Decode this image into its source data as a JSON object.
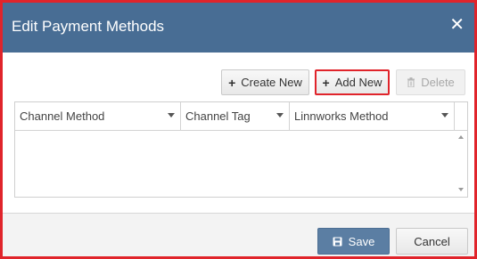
{
  "dialog": {
    "title": "Edit Payment Methods",
    "close_icon": "close-icon",
    "highlight_color": "#e0242b",
    "header_color": "#486d94"
  },
  "toolbar": {
    "create_new_label": "Create New",
    "add_new_label": "Add New",
    "delete_label": "Delete",
    "plus_glyph": "+"
  },
  "grid": {
    "columns": [
      {
        "label": "Channel Method"
      },
      {
        "label": "Channel Tag"
      },
      {
        "label": "Linnworks Method"
      }
    ],
    "rows": []
  },
  "footer": {
    "save_label": "Save",
    "cancel_label": "Cancel",
    "save_color": "#5b7ea3"
  }
}
